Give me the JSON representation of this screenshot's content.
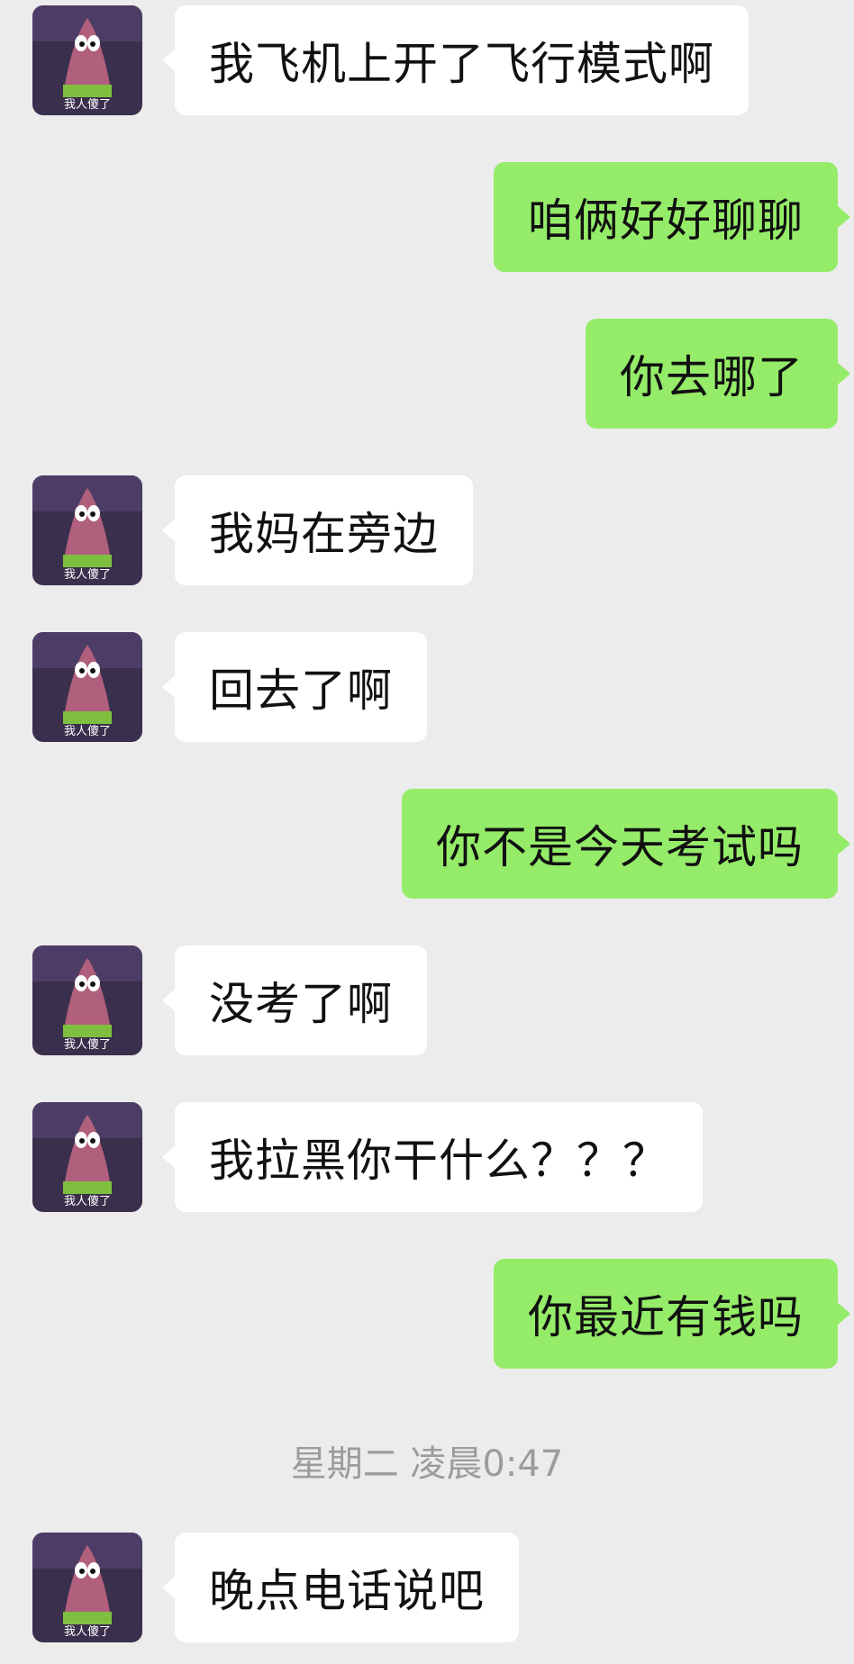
{
  "colors": {
    "background": "#ececec",
    "incoming_bubble": "#ffffff",
    "outgoing_bubble": "#95ec69",
    "text": "#111111",
    "timestamp": "#9c9c9c"
  },
  "contact": {
    "avatar_icon": "patrick-star-avatar-icon",
    "avatar_caption": "我人傻了"
  },
  "messages": [
    {
      "side": "in",
      "text": "我飞机上开了飞行模式啊"
    },
    {
      "side": "out",
      "text": "咱俩好好聊聊"
    },
    {
      "side": "out",
      "text": "你去哪了"
    },
    {
      "side": "in",
      "text": "我妈在旁边"
    },
    {
      "side": "in",
      "text": "回去了啊"
    },
    {
      "side": "out",
      "text": "你不是今天考试吗"
    },
    {
      "side": "in",
      "text": "没考了啊"
    },
    {
      "side": "in",
      "text": "我拉黑你干什么？？？"
    },
    {
      "side": "out",
      "text": "你最近有钱吗"
    }
  ],
  "timestamp": "星期二 凌晨0:47",
  "last_message": {
    "side": "in",
    "text": "晚点电话说吧"
  }
}
